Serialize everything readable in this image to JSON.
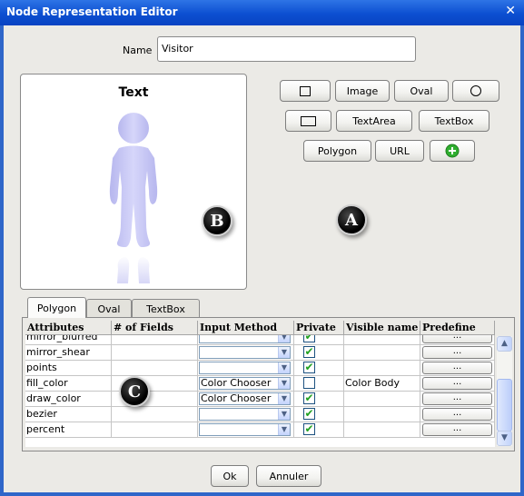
{
  "window": {
    "title": "Node Representation Editor",
    "close_glyph": "✕"
  },
  "form": {
    "name_label": "Name",
    "name_value": "Visitor"
  },
  "preview": {
    "text": "Text",
    "figure_color": "#c9c9f4"
  },
  "toolbar": {
    "rect_icon": "square-icon",
    "image": "Image",
    "oval": "Oval",
    "circle_icon": "circle-icon",
    "wide_rect_icon": "rectangle-icon",
    "textarea": "TextArea",
    "textbox": "TextBox",
    "polygon": "Polygon",
    "url": "URL",
    "add_icon": "add-icon"
  },
  "markers": {
    "a": "A",
    "b": "B",
    "c": "C"
  },
  "tabs": [
    "Polygon",
    "Oval",
    "TextBox"
  ],
  "table": {
    "headers": [
      "Attributes",
      "# of Fields",
      "Input Method",
      "Private",
      "Visible name",
      "Predefine"
    ],
    "ellipsis": "...",
    "rows": [
      {
        "attr": "mirror_blurred",
        "fields": "",
        "method": "",
        "private": true,
        "visible": ""
      },
      {
        "attr": "mirror_shear",
        "fields": "",
        "method": "",
        "private": true,
        "visible": ""
      },
      {
        "attr": "points",
        "fields": "",
        "method": "",
        "private": true,
        "visible": ""
      },
      {
        "attr": "fill_color",
        "fields": "",
        "method": "Color Chooser",
        "private": false,
        "visible": "Color Body"
      },
      {
        "attr": "draw_color",
        "fields": "",
        "method": "Color Chooser",
        "private": true,
        "visible": ""
      },
      {
        "attr": "bezier",
        "fields": "",
        "method": "",
        "private": true,
        "visible": ""
      },
      {
        "attr": "percent",
        "fields": "",
        "method": "",
        "private": true,
        "visible": ""
      }
    ]
  },
  "buttons": {
    "ok": "Ok",
    "cancel": "Annuler"
  },
  "colors": {
    "title_bar": "#0c4fd1",
    "dialog_bg": "#ebeae6",
    "check": "#21a121",
    "add_green": "#2fae2f"
  }
}
